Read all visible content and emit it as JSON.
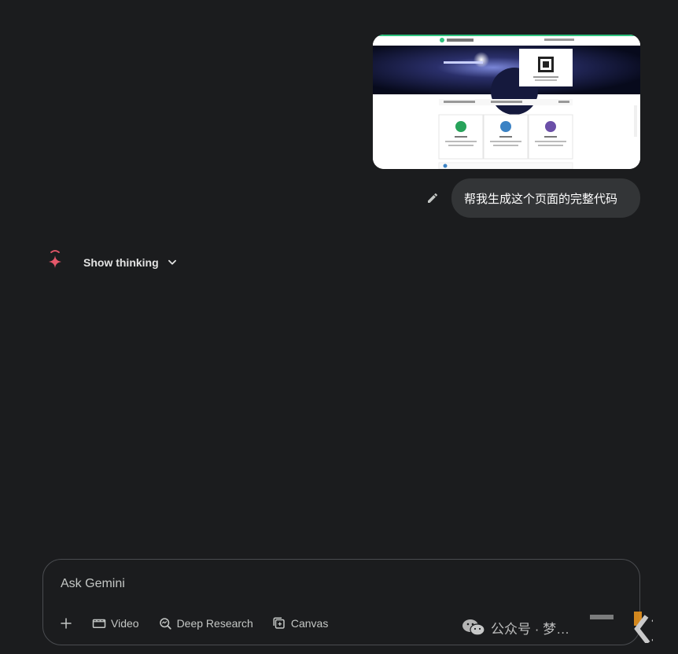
{
  "message": {
    "text": "帮我生成这个页面的完整代码",
    "attachment": {
      "site_title": "智能公众平台",
      "qr_note": "扫描二维码登录",
      "cards": [
        {
          "icon": "person-icon",
          "color": "#27a35a"
        },
        {
          "icon": "document-icon",
          "color": "#3b82c4"
        },
        {
          "icon": "link-icon",
          "color": "#6b4fa8"
        }
      ]
    }
  },
  "response": {
    "show_thinking_label": "Show thinking"
  },
  "input": {
    "placeholder": "Ask Gemini",
    "tools": [
      {
        "label": "Video",
        "icon": "video-icon"
      },
      {
        "label": "Deep Research",
        "icon": "deep-research-icon"
      },
      {
        "label": "Canvas",
        "icon": "canvas-icon"
      }
    ]
  },
  "watermark": {
    "text": "公众号 · 梦…"
  },
  "colors": {
    "background": "#1b1c1e",
    "bubble": "#333537",
    "gemini_spark": "#e5576a"
  }
}
